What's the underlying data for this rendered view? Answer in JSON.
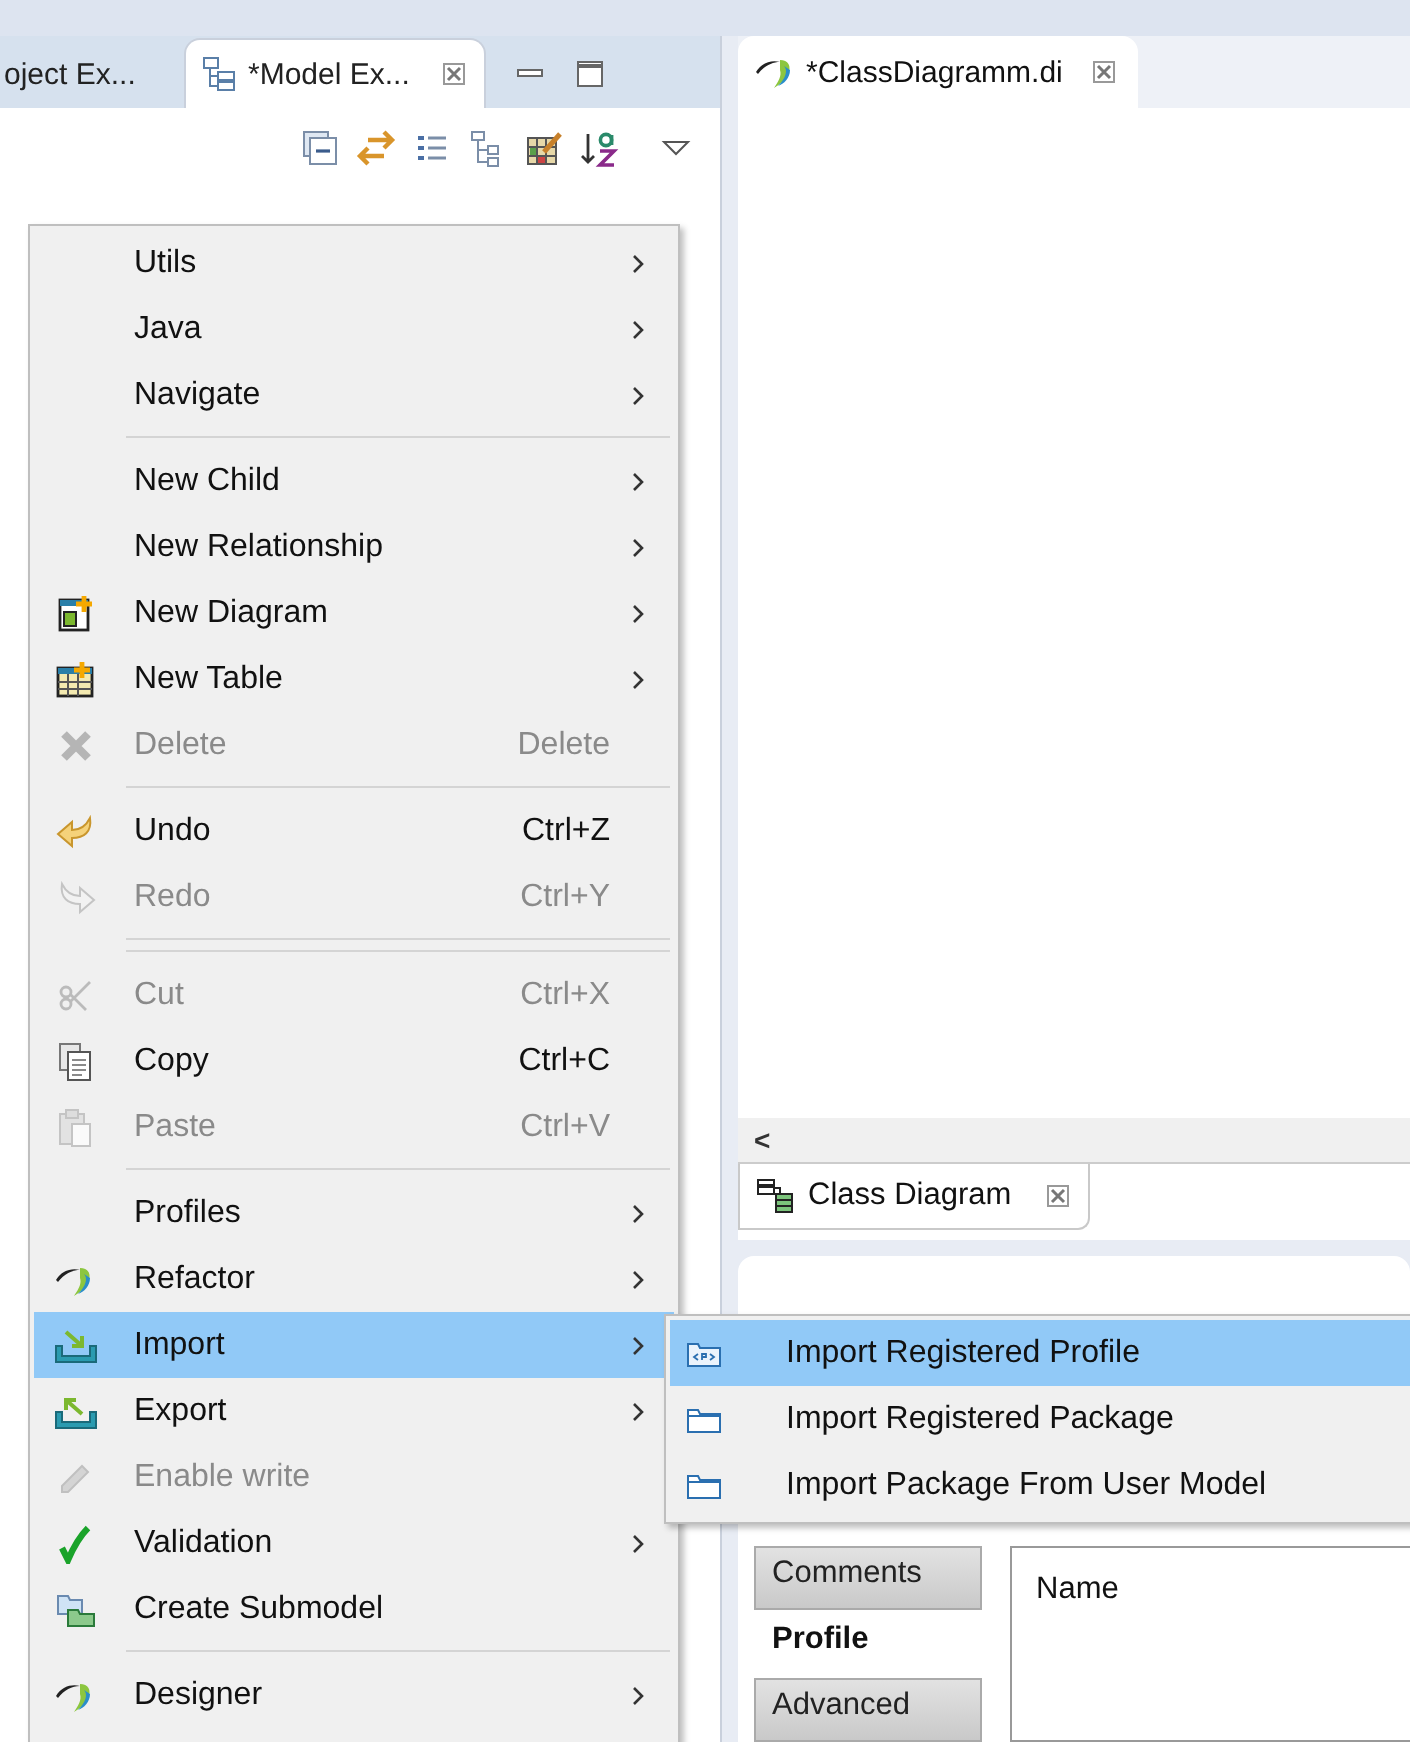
{
  "left_view": {
    "tabs": [
      {
        "label": "oject Ex...",
        "selected": false
      },
      {
        "label": "*Model Ex...",
        "selected": true
      }
    ]
  },
  "editor": {
    "tabs": [
      {
        "label": "*ClassDiagramm.di"
      }
    ],
    "scroll_left": "<",
    "diagram_tabs": [
      {
        "label": "Class Diagram"
      }
    ]
  },
  "properties": {
    "tabs": [
      {
        "label": "Comments",
        "selected": false
      },
      {
        "label": "Profile",
        "selected": true
      },
      {
        "label": "Advanced",
        "selected": false
      }
    ],
    "table": {
      "columns": [
        "Name"
      ]
    }
  },
  "context_menu": {
    "items": [
      {
        "kind": "item",
        "label": "Utils",
        "submenu": true,
        "disabled": false,
        "selected": false
      },
      {
        "kind": "item",
        "label": "Java",
        "submenu": true,
        "disabled": false,
        "selected": false
      },
      {
        "kind": "item",
        "label": "Navigate",
        "submenu": true,
        "disabled": false,
        "selected": false
      },
      {
        "kind": "separator"
      },
      {
        "kind": "item",
        "label": "New Child",
        "submenu": true,
        "disabled": false,
        "selected": false
      },
      {
        "kind": "item",
        "label": "New Relationship",
        "submenu": true,
        "disabled": false,
        "selected": false
      },
      {
        "kind": "item",
        "label": "New Diagram",
        "submenu": true,
        "disabled": false,
        "selected": false
      },
      {
        "kind": "item",
        "label": "New Table",
        "submenu": true,
        "disabled": false,
        "selected": false
      },
      {
        "kind": "item",
        "label": "Delete",
        "shortcut": "Delete",
        "submenu": false,
        "disabled": true,
        "selected": false
      },
      {
        "kind": "separator"
      },
      {
        "kind": "item",
        "label": "Undo",
        "shortcut": "Ctrl+Z",
        "submenu": false,
        "disabled": false,
        "selected": false
      },
      {
        "kind": "item",
        "label": "Redo",
        "shortcut": "Ctrl+Y",
        "submenu": false,
        "disabled": true,
        "selected": false
      },
      {
        "kind": "separator"
      },
      {
        "kind": "separator"
      },
      {
        "kind": "item",
        "label": "Cut",
        "shortcut": "Ctrl+X",
        "submenu": false,
        "disabled": true,
        "selected": false
      },
      {
        "kind": "item",
        "label": "Copy",
        "shortcut": "Ctrl+C",
        "submenu": false,
        "disabled": false,
        "selected": false
      },
      {
        "kind": "item",
        "label": "Paste",
        "shortcut": "Ctrl+V",
        "submenu": false,
        "disabled": true,
        "selected": false
      },
      {
        "kind": "separator"
      },
      {
        "kind": "item",
        "label": "Profiles",
        "submenu": true,
        "disabled": false,
        "selected": false
      },
      {
        "kind": "item",
        "label": "Refactor",
        "submenu": true,
        "disabled": false,
        "selected": false
      },
      {
        "kind": "item",
        "label": "Import",
        "submenu": true,
        "disabled": false,
        "selected": true
      },
      {
        "kind": "item",
        "label": "Export",
        "submenu": true,
        "disabled": false,
        "selected": false
      },
      {
        "kind": "item",
        "label": "Enable write",
        "submenu": false,
        "disabled": true,
        "selected": false
      },
      {
        "kind": "item",
        "label": "Validation",
        "submenu": true,
        "disabled": false,
        "selected": false
      },
      {
        "kind": "item",
        "label": "Create Submodel",
        "submenu": false,
        "disabled": false,
        "selected": false
      },
      {
        "kind": "separator"
      },
      {
        "kind": "item",
        "label": "Designer",
        "submenu": true,
        "disabled": false,
        "selected": false
      }
    ]
  },
  "submenu": {
    "items": [
      {
        "label": "Import Registered Profile",
        "selected": true
      },
      {
        "label": "Import Registered Package",
        "selected": false
      },
      {
        "label": "Import Package From User Model",
        "selected": false
      }
    ]
  }
}
